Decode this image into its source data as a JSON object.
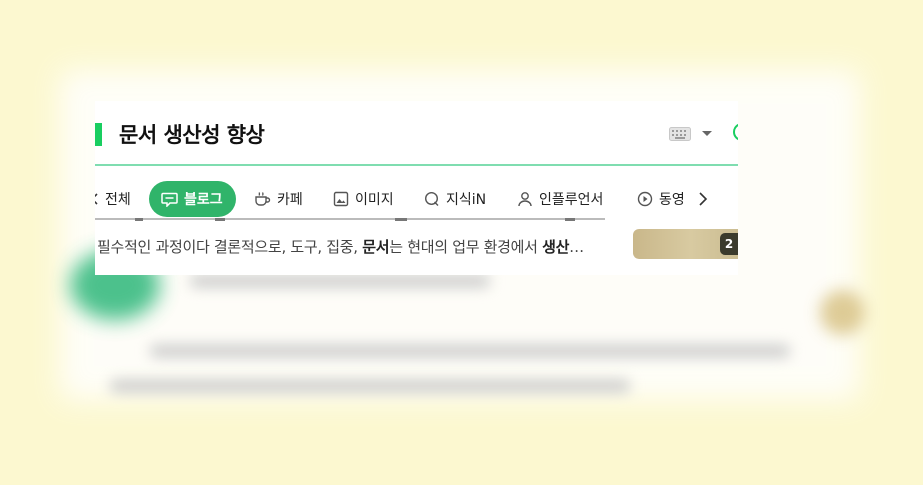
{
  "search": {
    "query": "문서 생산성 향상"
  },
  "tabs": [
    {
      "label": "전체",
      "icon": "chevron-left-icon"
    },
    {
      "label": "블로그",
      "icon": "blog-icon",
      "active": true
    },
    {
      "label": "카페",
      "icon": "cafe-icon"
    },
    {
      "label": "이미지",
      "icon": "image-icon"
    },
    {
      "label": "지식iN",
      "icon": "kin-icon"
    },
    {
      "label": "인플루언서",
      "icon": "person-icon"
    },
    {
      "label": "동영",
      "icon": "play-icon"
    }
  ],
  "result": {
    "snippet_pre": "필수적인 과정이다 결론적으로, 도구, 집중, ",
    "snippet_bold1": "문서",
    "snippet_mid": "는 현대의 업무 환경에서 ",
    "snippet_bold2": "생산",
    "snippet_post": "…",
    "thumb_badge": "2"
  },
  "colors": {
    "accent": "#19ce60",
    "active_tab": "#30b46a",
    "page_bg": "#fcf8d0"
  }
}
